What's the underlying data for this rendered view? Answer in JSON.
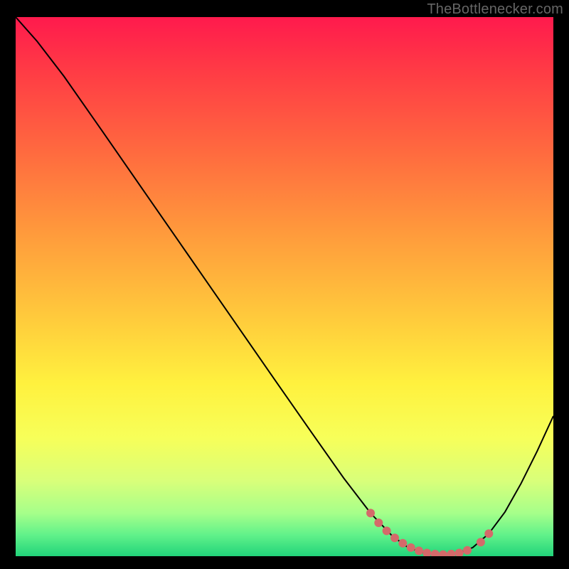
{
  "watermark": "TheBottlenecker.com",
  "chart_data": {
    "type": "line",
    "title": "",
    "xlabel": "",
    "ylabel": "",
    "xlim": [
      0,
      100
    ],
    "ylim": [
      0,
      100
    ],
    "background_gradient": {
      "stops": [
        {
          "offset": 0.0,
          "color": "#ff1a4d"
        },
        {
          "offset": 0.1,
          "color": "#ff3b45"
        },
        {
          "offset": 0.25,
          "color": "#ff6a3f"
        },
        {
          "offset": 0.4,
          "color": "#ff9a3c"
        },
        {
          "offset": 0.55,
          "color": "#ffc83c"
        },
        {
          "offset": 0.68,
          "color": "#fff13e"
        },
        {
          "offset": 0.78,
          "color": "#f7ff59"
        },
        {
          "offset": 0.86,
          "color": "#d9ff7a"
        },
        {
          "offset": 0.92,
          "color": "#a6ff8a"
        },
        {
          "offset": 0.96,
          "color": "#62f28a"
        },
        {
          "offset": 1.0,
          "color": "#21d47a"
        }
      ]
    },
    "series": [
      {
        "name": "bottleneck-curve",
        "stroke": "#000000",
        "points": [
          {
            "x": 0.0,
            "y": 100.0
          },
          {
            "x": 4.0,
            "y": 95.5
          },
          {
            "x": 9.0,
            "y": 89.0
          },
          {
            "x": 16.0,
            "y": 79.0
          },
          {
            "x": 24.0,
            "y": 67.5
          },
          {
            "x": 32.0,
            "y": 56.0
          },
          {
            "x": 40.0,
            "y": 44.5
          },
          {
            "x": 48.0,
            "y": 33.0
          },
          {
            "x": 55.0,
            "y": 23.0
          },
          {
            "x": 61.0,
            "y": 14.5
          },
          {
            "x": 66.0,
            "y": 8.0
          },
          {
            "x": 70.0,
            "y": 3.8
          },
          {
            "x": 73.0,
            "y": 1.6
          },
          {
            "x": 76.0,
            "y": 0.6
          },
          {
            "x": 79.0,
            "y": 0.3
          },
          {
            "x": 82.0,
            "y": 0.5
          },
          {
            "x": 85.0,
            "y": 1.6
          },
          {
            "x": 88.0,
            "y": 4.2
          },
          {
            "x": 91.0,
            "y": 8.2
          },
          {
            "x": 94.0,
            "y": 13.5
          },
          {
            "x": 97.0,
            "y": 19.5
          },
          {
            "x": 100.0,
            "y": 26.0
          }
        ]
      }
    ],
    "markers": {
      "name": "optimal-range-dots",
      "color": "#d46a6a",
      "radius_px": 6,
      "points": [
        {
          "x": 66.0,
          "y": 8.0
        },
        {
          "x": 67.5,
          "y": 6.2
        },
        {
          "x": 69.0,
          "y": 4.7
        },
        {
          "x": 70.5,
          "y": 3.4
        },
        {
          "x": 72.0,
          "y": 2.4
        },
        {
          "x": 73.5,
          "y": 1.6
        },
        {
          "x": 75.0,
          "y": 1.0
        },
        {
          "x": 76.5,
          "y": 0.6
        },
        {
          "x": 78.0,
          "y": 0.4
        },
        {
          "x": 79.5,
          "y": 0.3
        },
        {
          "x": 81.0,
          "y": 0.4
        },
        {
          "x": 82.5,
          "y": 0.6
        },
        {
          "x": 84.0,
          "y": 1.1
        },
        {
          "x": 86.5,
          "y": 2.6
        },
        {
          "x": 88.0,
          "y": 4.2
        }
      ]
    }
  }
}
